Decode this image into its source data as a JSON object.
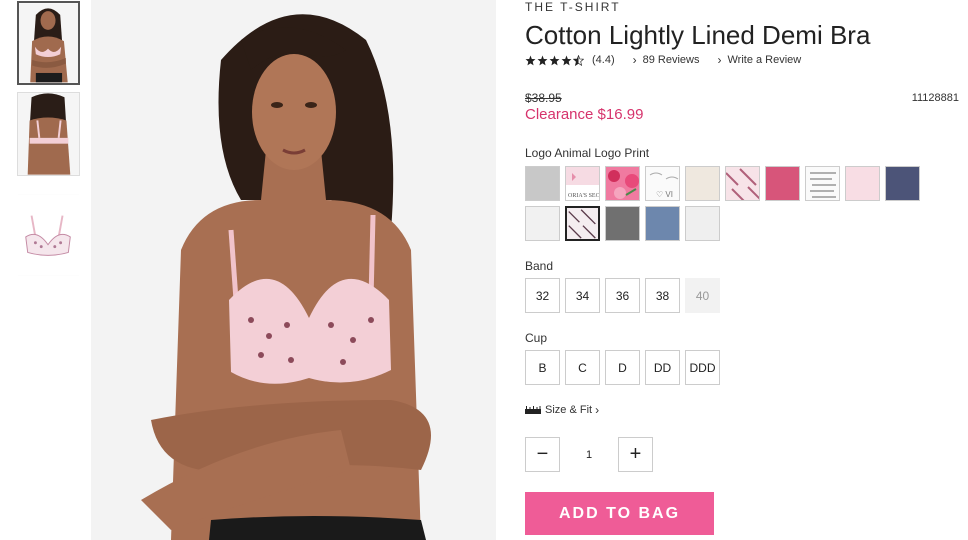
{
  "product": {
    "brand": "THE T-SHIRT",
    "title": "Cotton Lightly Lined Demi Bra",
    "rating_text": "(4.4)",
    "rating_value": 4.4,
    "reviews_link": "89 Reviews",
    "write_review_link": "Write a Review",
    "original_price": "$38.95",
    "sale_price": "Clearance $16.99",
    "sku": "11128881"
  },
  "color": {
    "selected_label": "Logo Animal Logo Print",
    "swatches": [
      {
        "name": "gray",
        "color": "#c8c8c8"
      },
      {
        "name": "pink-logo-print",
        "color": "#f6dbe3"
      },
      {
        "name": "floral",
        "color": "#e2507e"
      },
      {
        "name": "white-script",
        "color": "#f4f4f4"
      },
      {
        "name": "cream",
        "color": "#efe8df"
      },
      {
        "name": "pink-stripe-print",
        "color": "#f2d5dc"
      },
      {
        "name": "rose",
        "color": "#d7557a"
      },
      {
        "name": "white-logo-text",
        "color": "#f7f5f5"
      },
      {
        "name": "light-pink",
        "color": "#f8dde4"
      },
      {
        "name": "navy-heather",
        "color": "#4c5478"
      },
      {
        "name": "white",
        "color": "#f1f1f1"
      },
      {
        "name": "logo-animal-print",
        "color": "#efe6ea"
      },
      {
        "name": "charcoal",
        "color": "#707070"
      },
      {
        "name": "denim-blue",
        "color": "#6d87ad"
      },
      {
        "name": "off-white",
        "color": "#efefef"
      }
    ]
  },
  "band": {
    "label": "Band",
    "options": [
      {
        "label": "32",
        "available": true
      },
      {
        "label": "34",
        "available": true
      },
      {
        "label": "36",
        "available": true
      },
      {
        "label": "38",
        "available": true
      },
      {
        "label": "40",
        "available": false
      }
    ]
  },
  "cup": {
    "label": "Cup",
    "options": [
      {
        "label": "B",
        "available": true
      },
      {
        "label": "C",
        "available": true
      },
      {
        "label": "D",
        "available": true
      },
      {
        "label": "DD",
        "available": true
      },
      {
        "label": "DDD",
        "available": true
      }
    ]
  },
  "size_fit_link": "Size & Fit",
  "quantity": {
    "value": "1",
    "minus": "−",
    "plus": "+"
  },
  "add_to_bag": "ADD TO BAG",
  "colors": {
    "clearance": "#d6336c",
    "add_to_bag_bg": "#ef5c97",
    "bra_pink": "#f3cfd6"
  }
}
